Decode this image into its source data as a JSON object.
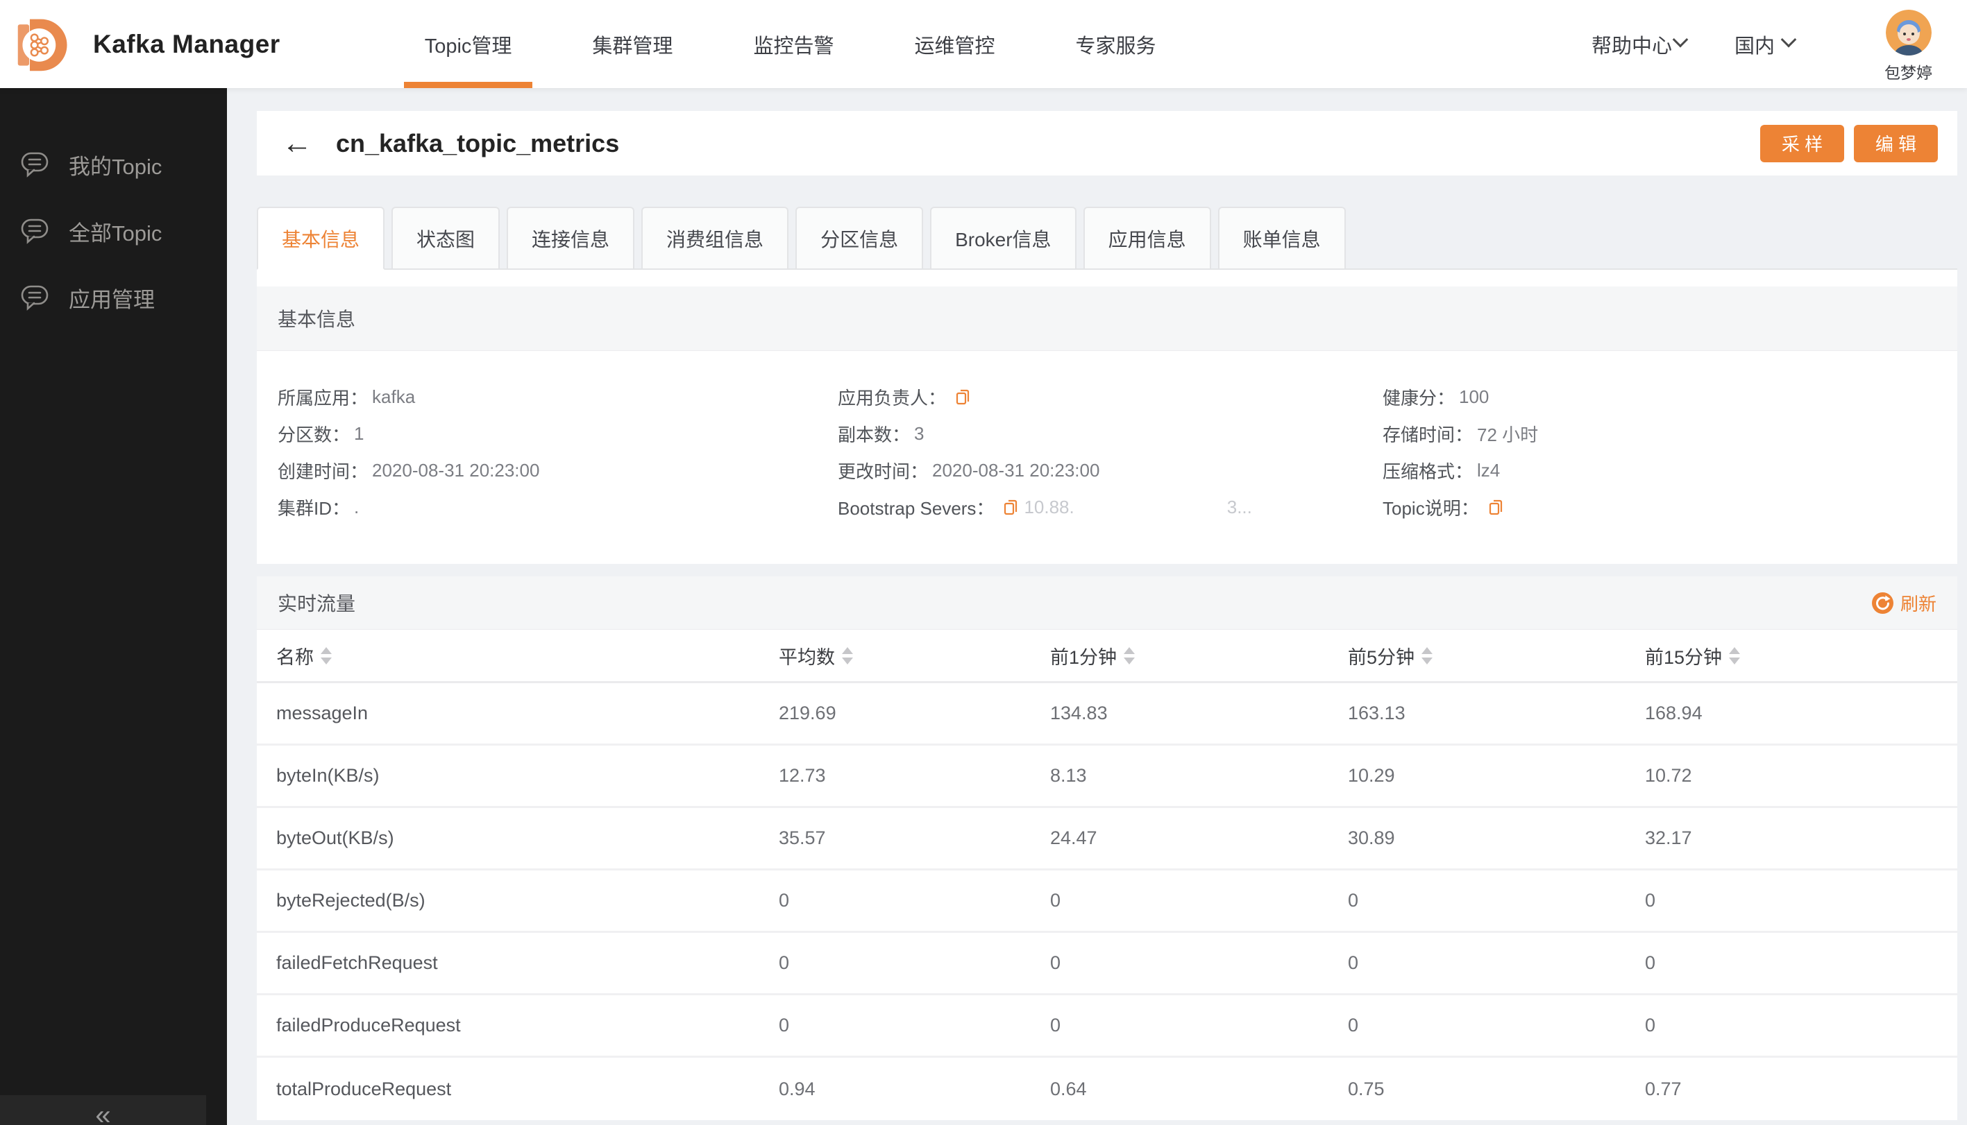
{
  "colors": {
    "accent": "#ED8335",
    "sidebar_bg": "#1B1B1B",
    "page_bg": "#EFF1F4"
  },
  "brand": {
    "title": "Kafka Manager",
    "logo_icon": "kafka-cluster-d-logo"
  },
  "nav": {
    "items": [
      {
        "label": "Topic管理",
        "active": true
      },
      {
        "label": "集群管理",
        "active": false
      },
      {
        "label": "监控告警",
        "active": false
      },
      {
        "label": "运维管控",
        "active": false
      },
      {
        "label": "专家服务",
        "active": false
      }
    ],
    "help_label": "帮助中心",
    "region_label": "国内",
    "user_name": "包梦婷"
  },
  "sidebar": {
    "items": [
      {
        "label": "我的Topic",
        "icon": "chat-bubble-icon"
      },
      {
        "label": "全部Topic",
        "icon": "clipboard-icon"
      },
      {
        "label": "应用管理",
        "icon": "alarm-icon"
      }
    ],
    "collapse_icon": "«"
  },
  "page": {
    "back_icon": "←",
    "title": "cn_kafka_topic_metrics",
    "sample_button": "采 样",
    "edit_button": "编 辑"
  },
  "tabs": [
    {
      "label": "基本信息",
      "active": true
    },
    {
      "label": "状态图",
      "active": false
    },
    {
      "label": "连接信息",
      "active": false
    },
    {
      "label": "消费组信息",
      "active": false
    },
    {
      "label": "分区信息",
      "active": false
    },
    {
      "label": "Broker信息",
      "active": false
    },
    {
      "label": "应用信息",
      "active": false
    },
    {
      "label": "账单信息",
      "active": false
    }
  ],
  "basic_info": {
    "section_title": "基本信息",
    "fields": [
      {
        "label": "所属应用：",
        "value": "kafka"
      },
      {
        "label": "应用负责人：",
        "value": "",
        "copy": true
      },
      {
        "label": "健康分：",
        "value": "100"
      },
      {
        "label": "分区数：",
        "value": "1"
      },
      {
        "label": "副本数：",
        "value": "3"
      },
      {
        "label": "存储时间：",
        "value": "72 小时"
      },
      {
        "label": "创建时间：",
        "value": "2020-08-31 20:23:00"
      },
      {
        "label": "更改时间：",
        "value": "2020-08-31 20:23:00"
      },
      {
        "label": "压缩格式：",
        "value": "lz4"
      },
      {
        "label": "集群ID：",
        "value": "."
      },
      {
        "label": "Bootstrap Severs：",
        "value": "10.88.",
        "value2": "3...",
        "copy": true,
        "faded": true
      },
      {
        "label": "Topic说明：",
        "value": "",
        "copy": true
      }
    ]
  },
  "realtime": {
    "section_title": "实时流量",
    "refresh_label": "刷新",
    "table": {
      "columns": [
        "名称",
        "平均数",
        "前1分钟",
        "前5分钟",
        "前15分钟"
      ],
      "rows": [
        {
          "name": "messageIn",
          "avg": "219.69",
          "m1": "134.83",
          "m5": "163.13",
          "m15": "168.94"
        },
        {
          "name": "byteIn(KB/s)",
          "avg": "12.73",
          "m1": "8.13",
          "m5": "10.29",
          "m15": "10.72"
        },
        {
          "name": "byteOut(KB/s)",
          "avg": "35.57",
          "m1": "24.47",
          "m5": "30.89",
          "m15": "32.17"
        },
        {
          "name": "byteRejected(B/s)",
          "avg": "0",
          "m1": "0",
          "m5": "0",
          "m15": "0"
        },
        {
          "name": "failedFetchRequest",
          "avg": "0",
          "m1": "0",
          "m5": "0",
          "m15": "0"
        },
        {
          "name": "failedProduceRequest",
          "avg": "0",
          "m1": "0",
          "m5": "0",
          "m15": "0"
        },
        {
          "name": "totalProduceRequest",
          "avg": "0.94",
          "m1": "0.64",
          "m5": "0.75",
          "m15": "0.77"
        }
      ]
    }
  }
}
